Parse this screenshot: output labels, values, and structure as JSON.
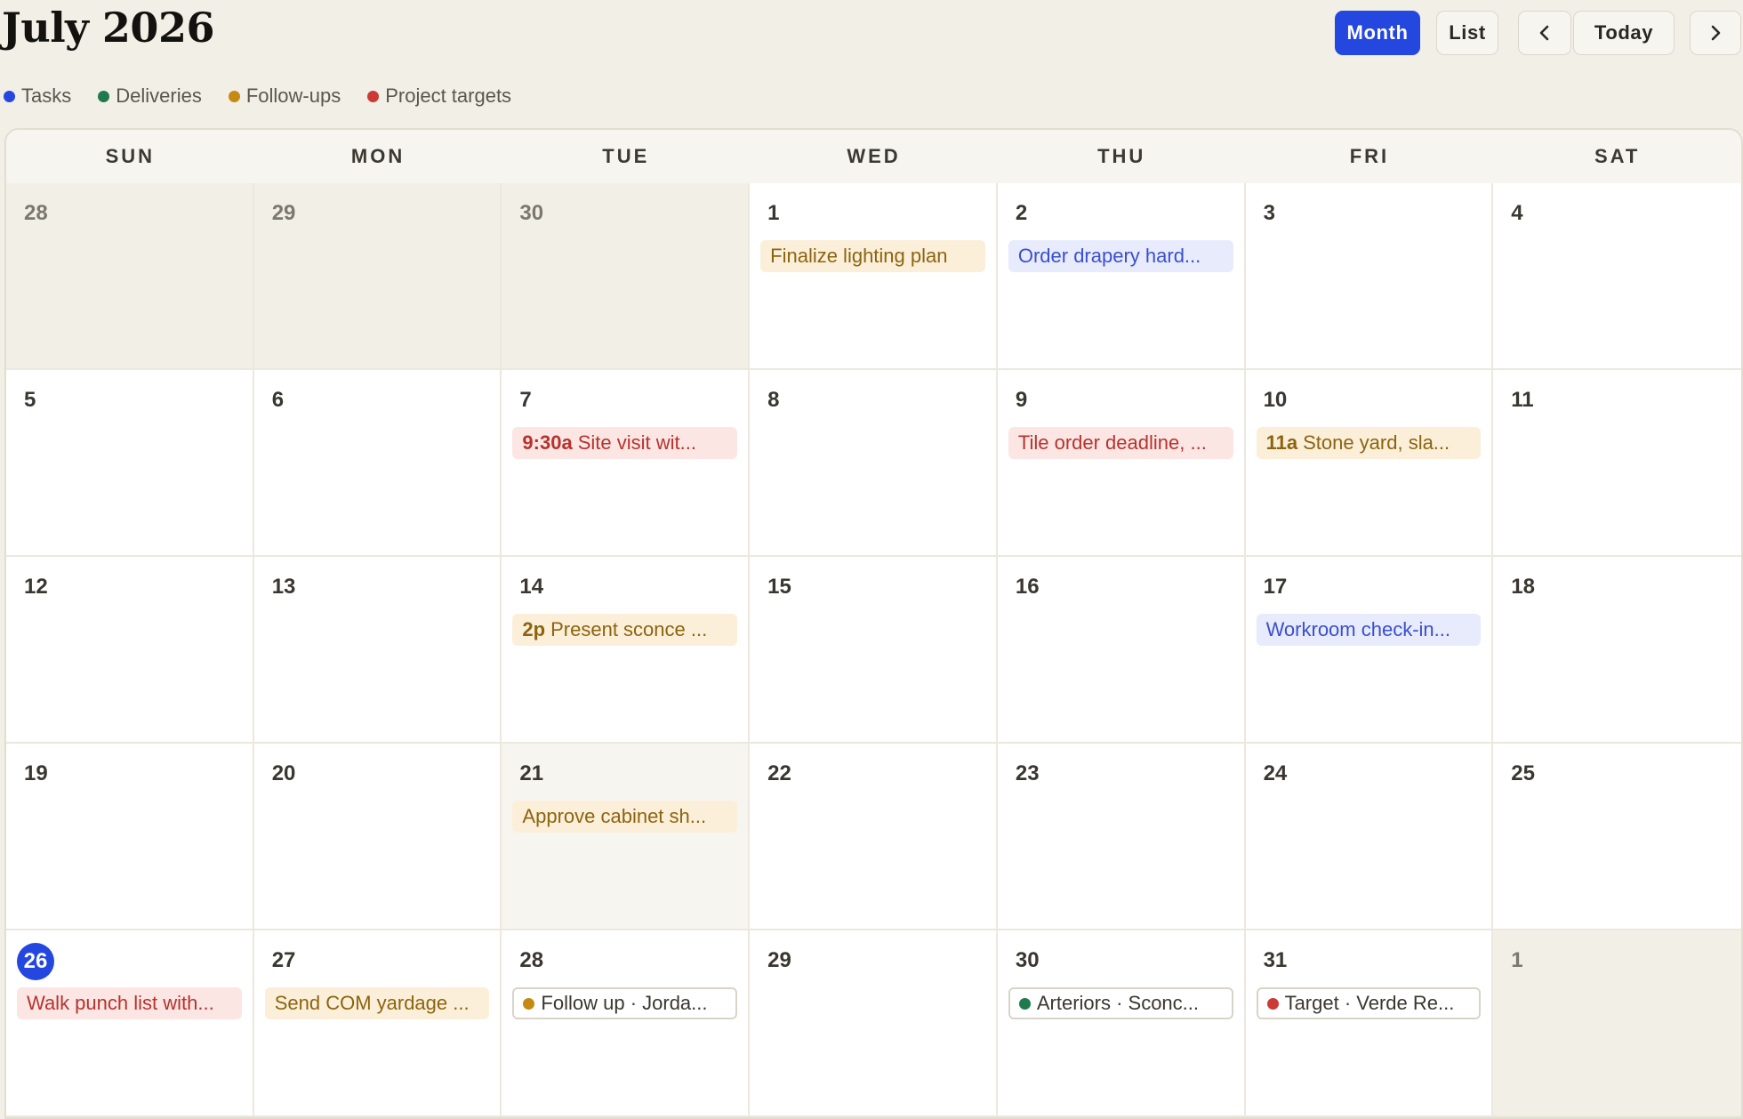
{
  "title": "July 2026",
  "toolbar": {
    "month_label": "Month",
    "list_label": "List",
    "today_label": "Today",
    "prev_icon": "chevron-left-icon",
    "next_icon": "chevron-right-icon",
    "active_view": "Month"
  },
  "legend": [
    {
      "label": "Tasks",
      "color": "#2447e0"
    },
    {
      "label": "Deliveries",
      "color": "#1f7a4d"
    },
    {
      "label": "Follow-ups",
      "color": "#c48a12"
    },
    {
      "label": "Project targets",
      "color": "#cc3a36"
    }
  ],
  "weekdays": [
    "SUN",
    "MON",
    "TUE",
    "WED",
    "THU",
    "FRI",
    "SAT"
  ],
  "colors": {
    "task": "#2447e0",
    "delivery": "#1f7a4d",
    "followup": "#c48a12",
    "target": "#cc3a36"
  },
  "weeks": [
    [
      {
        "day": "28",
        "state": "muted"
      },
      {
        "day": "29",
        "state": "muted"
      },
      {
        "day": "30",
        "state": "muted"
      },
      {
        "day": "1",
        "events": [
          {
            "style": "followup",
            "text": "Finalize lighting plan"
          }
        ]
      },
      {
        "day": "2",
        "events": [
          {
            "style": "task",
            "text": "Order drapery hard..."
          }
        ]
      },
      {
        "day": "3"
      },
      {
        "day": "4"
      }
    ],
    [
      {
        "day": "5"
      },
      {
        "day": "6"
      },
      {
        "day": "7",
        "events": [
          {
            "style": "target",
            "time": "9:30a",
            "text": "Site visit wit..."
          }
        ]
      },
      {
        "day": "8"
      },
      {
        "day": "9",
        "events": [
          {
            "style": "target",
            "text": "Tile order deadline, ..."
          }
        ]
      },
      {
        "day": "10",
        "events": [
          {
            "style": "followup",
            "time": "11a",
            "text": "Stone yard, sla..."
          }
        ]
      },
      {
        "day": "11"
      }
    ],
    [
      {
        "day": "12"
      },
      {
        "day": "13"
      },
      {
        "day": "14",
        "events": [
          {
            "style": "followup",
            "time": "2p",
            "text": "Present sconce ..."
          }
        ]
      },
      {
        "day": "15"
      },
      {
        "day": "16"
      },
      {
        "day": "17",
        "events": [
          {
            "style": "task",
            "text": "Workroom check-in..."
          }
        ]
      },
      {
        "day": "18"
      }
    ],
    [
      {
        "day": "19"
      },
      {
        "day": "20"
      },
      {
        "day": "21",
        "state": "shaded",
        "events": [
          {
            "style": "followup",
            "text": "Approve cabinet sh..."
          }
        ]
      },
      {
        "day": "22"
      },
      {
        "day": "23"
      },
      {
        "day": "24"
      },
      {
        "day": "25"
      }
    ],
    [
      {
        "day": "26",
        "today": true,
        "events": [
          {
            "style": "target",
            "text": "Walk punch list with..."
          }
        ]
      },
      {
        "day": "27",
        "events": [
          {
            "style": "followup",
            "text": "Send COM yardage ..."
          }
        ]
      },
      {
        "day": "28",
        "events": [
          {
            "style": "outline",
            "dot": "followup",
            "text": "Follow up · Jorda..."
          }
        ]
      },
      {
        "day": "29"
      },
      {
        "day": "30",
        "events": [
          {
            "style": "outline",
            "dot": "delivery",
            "text": "Arteriors · Sconc..."
          }
        ]
      },
      {
        "day": "31",
        "events": [
          {
            "style": "outline",
            "dot": "target",
            "text": "Target · Verde Re..."
          }
        ]
      },
      {
        "day": "1",
        "state": "muted"
      }
    ]
  ]
}
